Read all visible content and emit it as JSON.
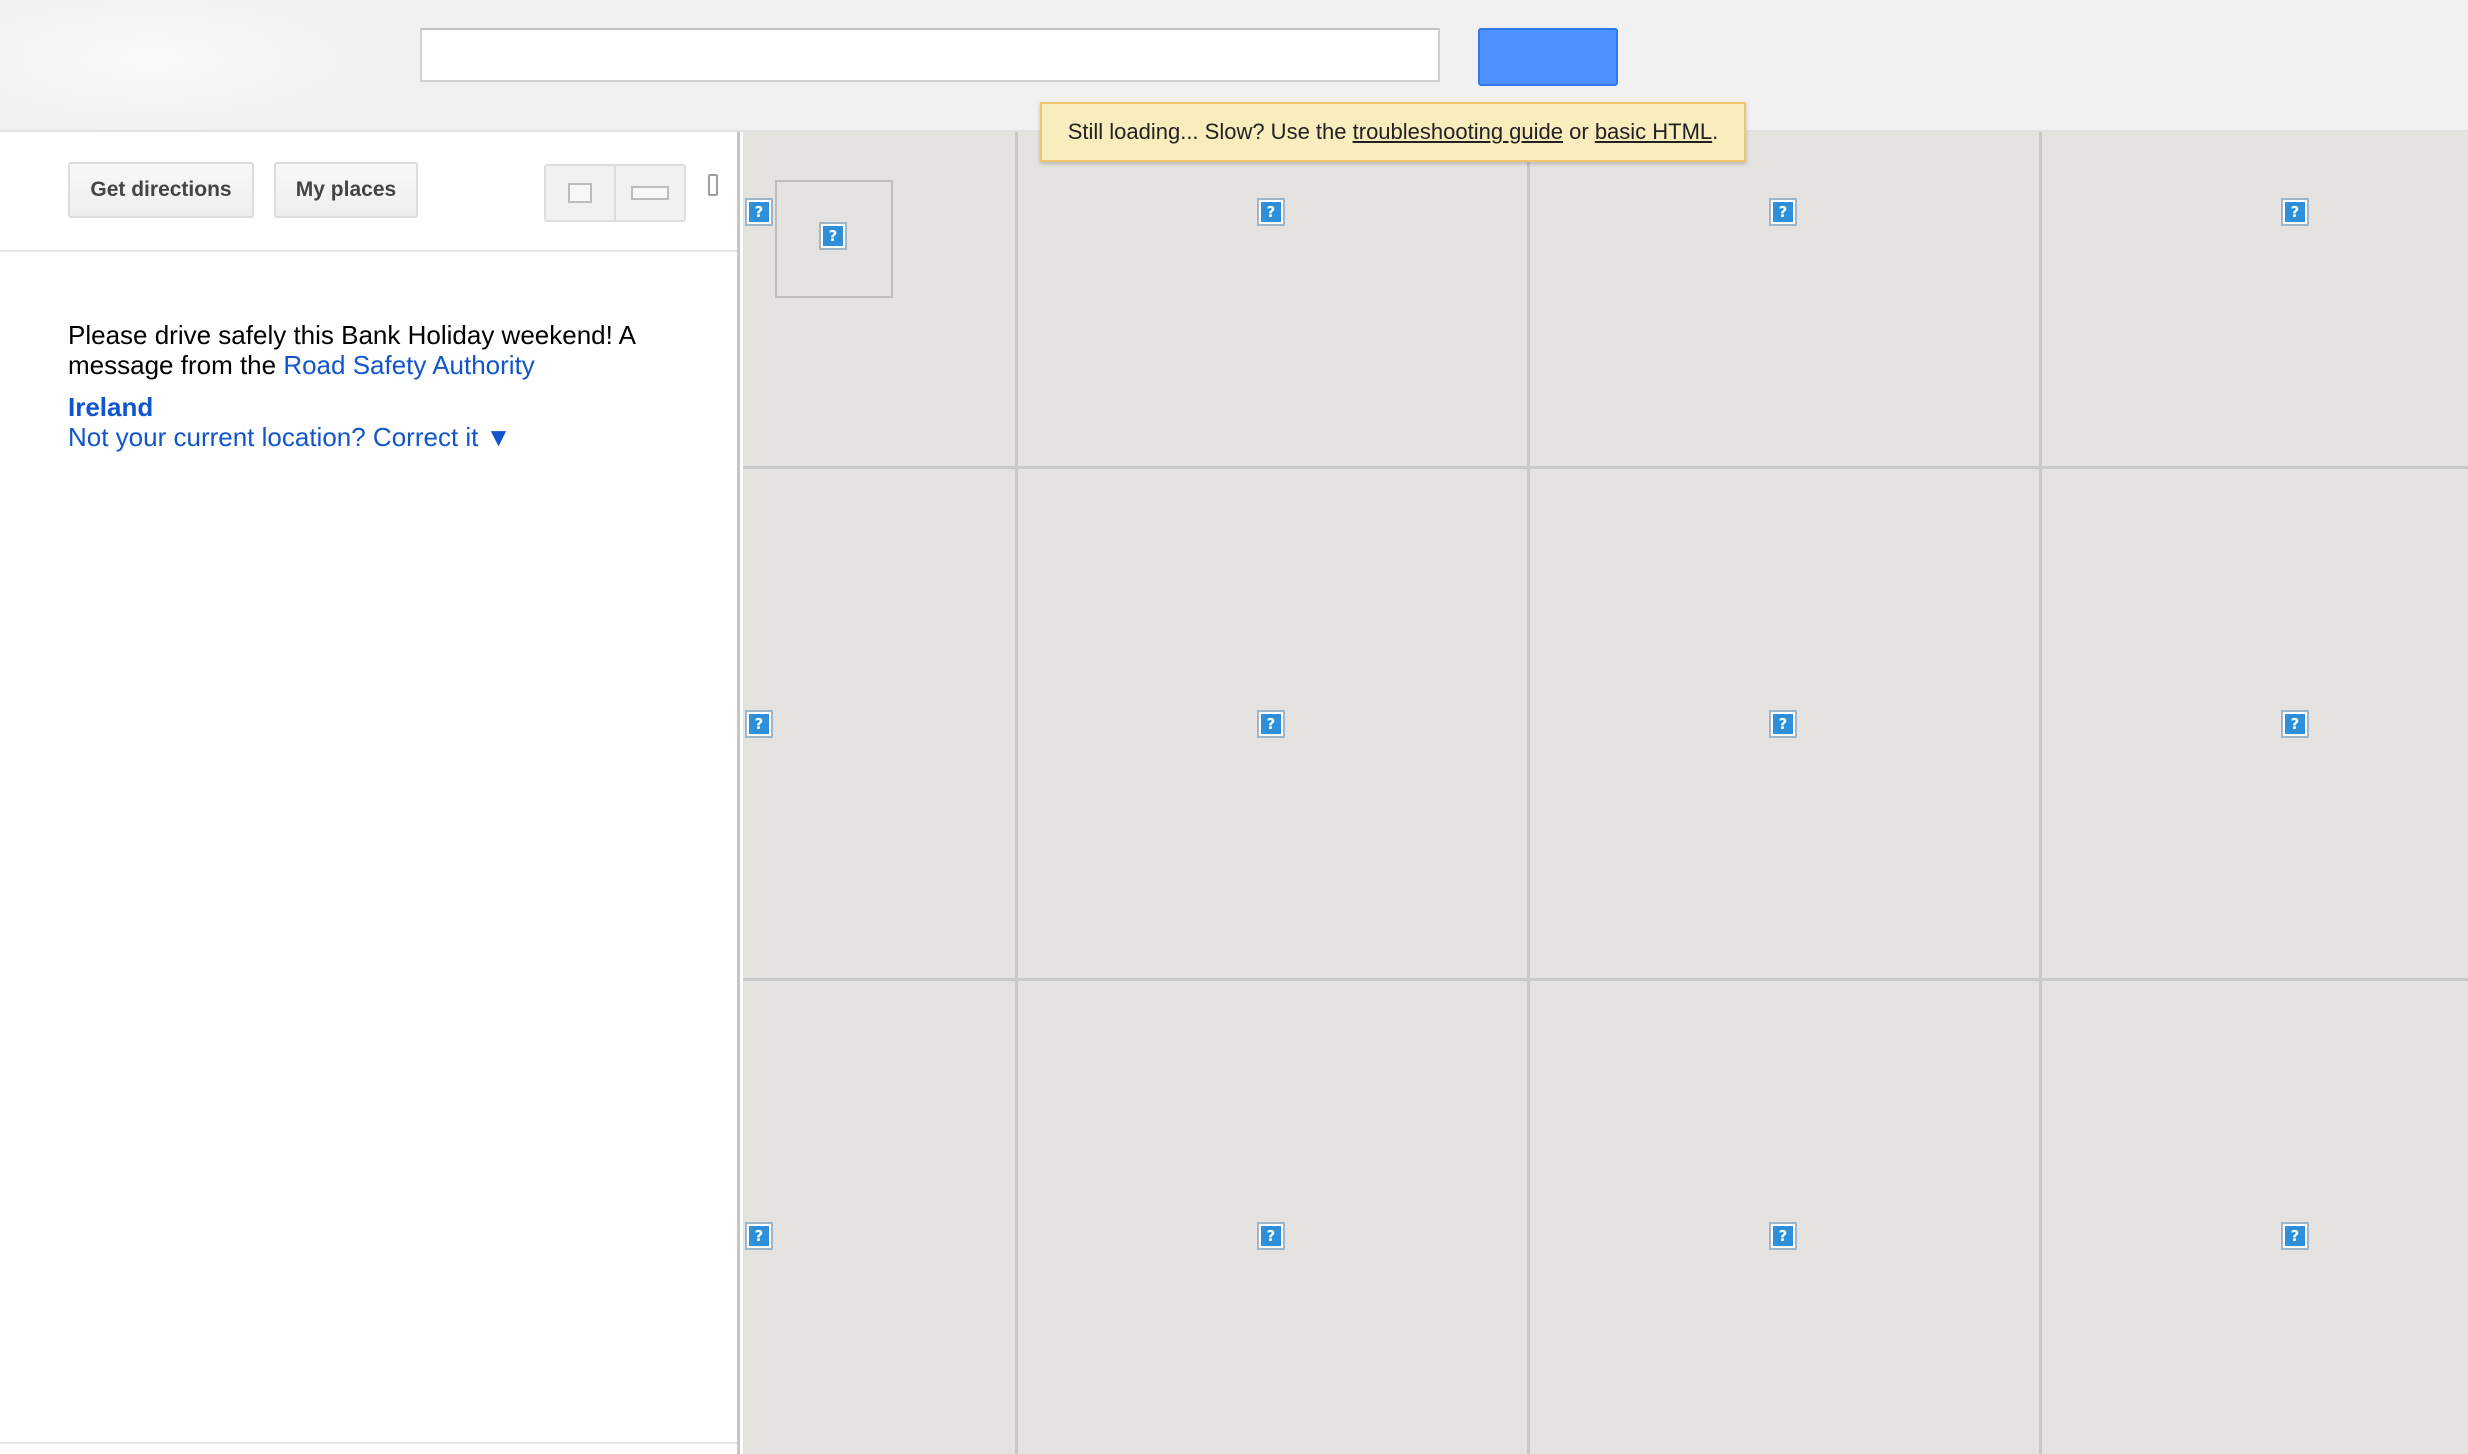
{
  "header": {
    "search_value": "",
    "search_button_label": ""
  },
  "loading_notice": {
    "prefix": "Still loading... Slow? Use the ",
    "troubleshooting_link": "troubleshooting guide",
    "middle": " or ",
    "basic_html_link": "basic HTML",
    "suffix": "."
  },
  "toolbar": {
    "get_directions_label": "Get directions",
    "my_places_label": "My places"
  },
  "panel": {
    "message_text": "Please drive safely this Bank Holiday weekend! A message from the ",
    "message_link": "Road Safety Authority",
    "location_name": "Ireland",
    "correct_location_link": "Not your current location? Correct it ▼"
  },
  "map": {
    "broken_image_glyph": "?",
    "tile_background": "#e5e3df",
    "grid_line_color": "#c8c8c8"
  },
  "colors": {
    "link": "#1155cc",
    "search_button": "#4d90fe",
    "notice_background": "#f9edbe",
    "notice_border": "#f0c36d"
  }
}
